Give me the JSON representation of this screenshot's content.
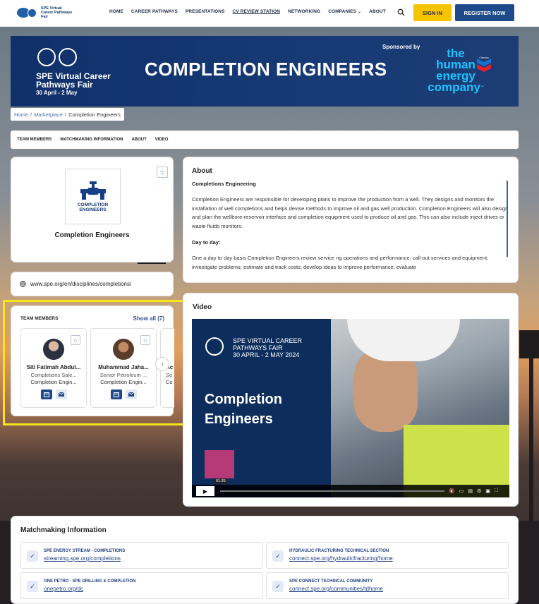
{
  "header": {
    "logo_text": "SPE Virtual Career Pathways Fair",
    "nav": [
      "HOME",
      "CAREER PATHWAYS",
      "PRESENTATIONS",
      "CV REVIEW STATION",
      "NETWORKING",
      "COMPANIES",
      "ABOUT"
    ],
    "active_nav": "CV REVIEW STATION",
    "signin": "SIGN IN",
    "register": "REGISTER NOW",
    "colors": {
      "signin_bg": "#f6c400",
      "register_bg": "#1f4a8a"
    }
  },
  "banner": {
    "event_name": "SPE Virtual Career Pathways Fair",
    "dates": "30 April - 2 May",
    "headline": "COMPLETION ENGINEERS",
    "sponsored_by": "Sponsored by",
    "sponsor_line1": "the",
    "sponsor_line2": "human",
    "sponsor_line3": "energy",
    "sponsor_line4": "company",
    "sponsor_tm": "™",
    "sponsor_chevron_text": "Chevron"
  },
  "breadcrumb": {
    "home": "Home",
    "marketplace": "Marketplace",
    "current": "Completion Engineers"
  },
  "tabs": [
    "TEAM MEMBERS",
    "MATCHMAKING INFORMATION",
    "ABOUT",
    "VIDEO"
  ],
  "profile": {
    "logo_label": "COMPLETION ENGINEERS",
    "name": "Completion Engineers",
    "website": "www.spe.org/en/disciplines/completions/"
  },
  "team": {
    "title": "TEAM MEMBERS",
    "show_all": "Show all (7)",
    "members": [
      {
        "name": "Siti Fatimah Abdul...",
        "role": "Completions Sale...",
        "company": "Completion Engin..."
      },
      {
        "name": "Muhammad Jaha...",
        "role": "Senior Petroleum ...",
        "company": "Completion Engin..."
      },
      {
        "name": "Ac",
        "role": "Se",
        "company": "Co"
      }
    ]
  },
  "about": {
    "title": "About",
    "subtitle": "Completions Engineering",
    "para1": "Completion Engineers are responsible for developing plans to improve the production from a well. They designs and monitors the installation of well completions and helps devise methods to improve oil and gas well production. Completion Engineers will also design and plan the wellbore-reservoir interface and completion equipment used to produce oil and gas. This can also include inject drives or waste fluids monitors.",
    "day_heading": "Day to day:",
    "para2": "One a day to day basis Completion Engineers review service rig operations and performance; call-out services and equipment; investigate problems; estimate and track costs; develop ideas to improve performance; evaluate"
  },
  "video": {
    "title": "Video",
    "overlay_event": "SPE VIRTUAL CAREER PATHWAYS FAIR",
    "overlay_dates": "30 APRIL - 2 MAY 2024",
    "overlay_title_1": "Completion",
    "overlay_title_2": "Engineers",
    "timestamp": "01:35"
  },
  "matchmaking": {
    "title": "Matchmaking Information",
    "items": [
      {
        "label": "SPE ENERGY STREAM - COMPLETIONS",
        "link": "streaming.spe.org/completions"
      },
      {
        "label": "HYDRAULIC FRACTURING TECHNICAL SECTION",
        "link": "connect.spe.org/hydraulicfracturing/home"
      },
      {
        "label": "ONE PETRO - SPE DRILLING & COMPLETION",
        "link": "onepetro.org/dc"
      },
      {
        "label": "SPE CONNECT TECHNICAL COMMUNITY",
        "link": "connect.spe.org/communities/tdhome"
      }
    ]
  }
}
